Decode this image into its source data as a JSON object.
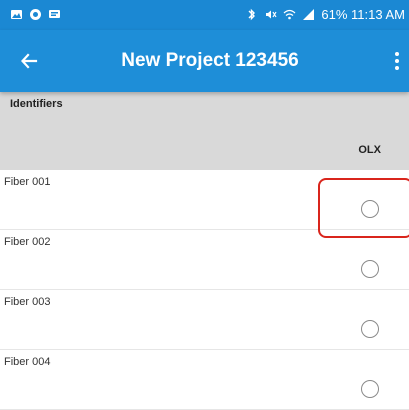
{
  "status_bar": {
    "right_text": "61% 11:13 AM"
  },
  "app_bar": {
    "title": "New Project 123456"
  },
  "table": {
    "header_label": "Identifiers",
    "column_label": "OLX",
    "rows": [
      {
        "label": "Fiber 001"
      },
      {
        "label": "Fiber 002"
      },
      {
        "label": "Fiber 003"
      },
      {
        "label": "Fiber 004"
      }
    ]
  },
  "colors": {
    "status_bar": "#1b88d3",
    "app_bar": "#1e8ed8",
    "header_bg": "#d9d9d9",
    "highlight": "#d9251c"
  },
  "icons": {
    "back": "arrow-left-icon",
    "overflow": "more-vertical-icon"
  }
}
